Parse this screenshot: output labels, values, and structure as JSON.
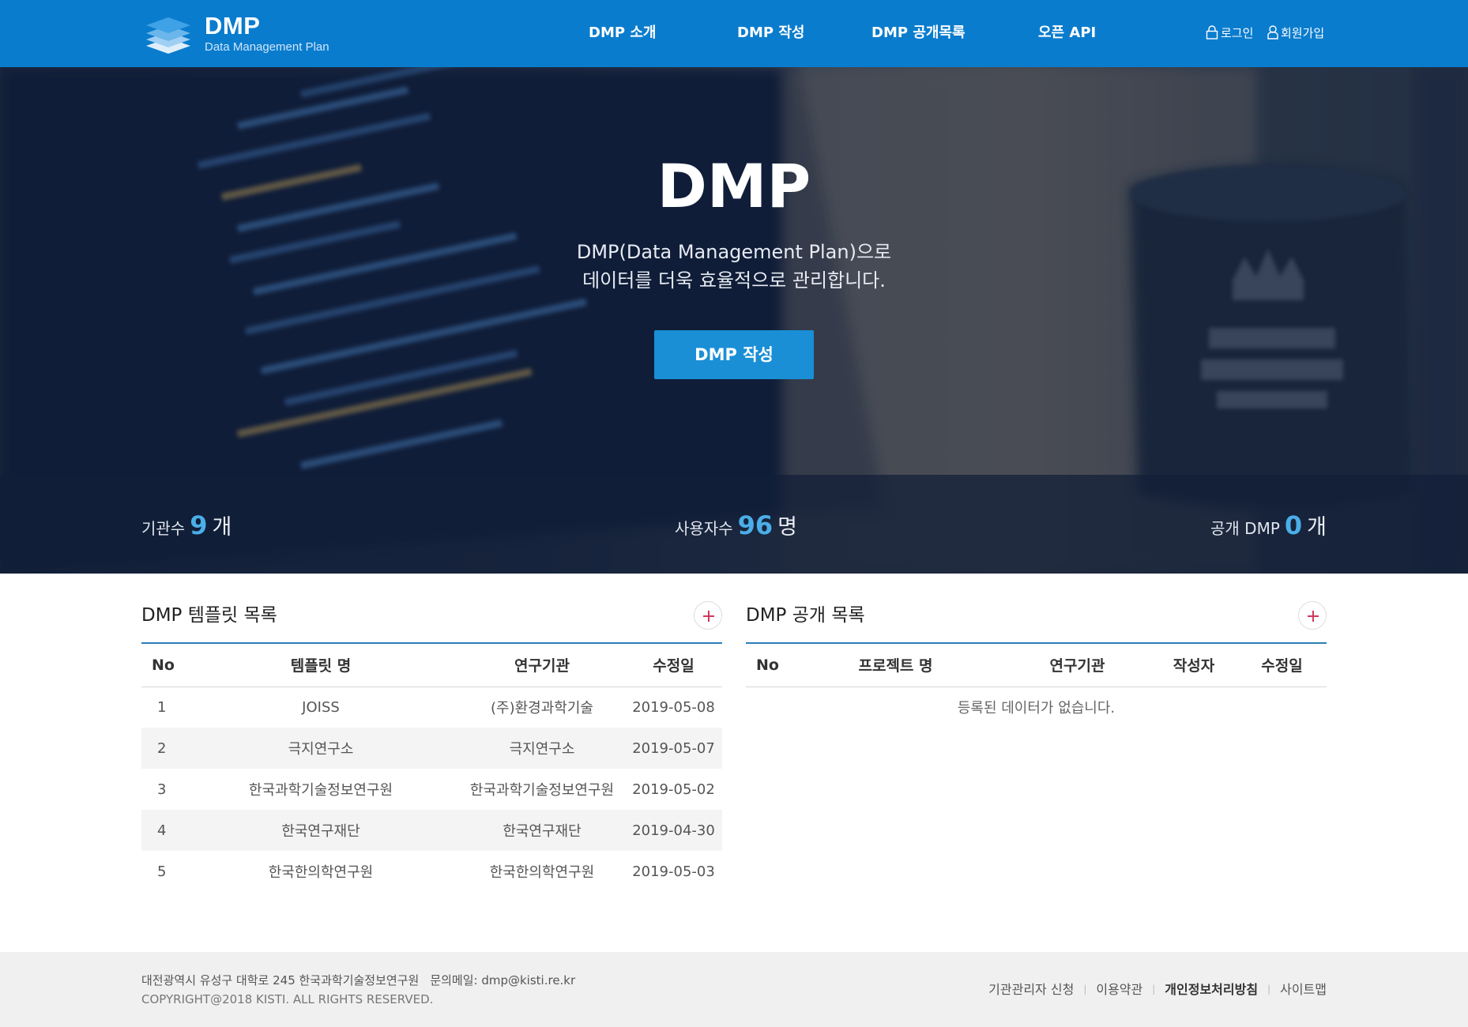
{
  "header": {
    "logo_title": "DMP",
    "logo_sub": "Data Management Plan",
    "nav": [
      "DMP 소개",
      "DMP 작성",
      "DMP 공개목록",
      "오픈 API"
    ],
    "login": "로그인",
    "signup": "회원가입",
    "colors": {
      "bar": "#0a7ccd"
    }
  },
  "hero": {
    "title": "DMP",
    "subtitle_line1": "DMP(Data Management Plan)으로",
    "subtitle_line2": "데이터를 더욱 효율적으로 관리합니다.",
    "button": "DMP 작성"
  },
  "stats": [
    {
      "label": "기관수",
      "value": "9",
      "unit": "개"
    },
    {
      "label": "사용자수",
      "value": "96",
      "unit": "명"
    },
    {
      "label": "공개 DMP",
      "value": "0",
      "unit": "개"
    }
  ],
  "template_panel": {
    "title": "DMP 템플릿 목록",
    "columns": [
      "No",
      "템플릿 명",
      "연구기관",
      "수정일"
    ],
    "rows": [
      [
        "1",
        "JOISS",
        "(주)환경과학기술",
        "2019-05-08"
      ],
      [
        "2",
        "극지연구소",
        "극지연구소",
        "2019-05-07"
      ],
      [
        "3",
        "한국과학기술정보연구원",
        "한국과학기술정보연구원",
        "2019-05-02"
      ],
      [
        "4",
        "한국연구재단",
        "한국연구재단",
        "2019-04-30"
      ],
      [
        "5",
        "한국한의학연구원",
        "한국한의학연구원",
        "2019-05-03"
      ]
    ]
  },
  "public_panel": {
    "title": "DMP 공개 목록",
    "columns": [
      "No",
      "프로젝트 명",
      "연구기관",
      "작성자",
      "수정일"
    ],
    "empty_message": "등록된 데이터가 없습니다."
  },
  "footer": {
    "address": "대전광역시 유성구 대학로 245 한국과학기술정보연구원",
    "email": "문의메일: dmp@kisti.re.kr",
    "copyright": "COPYRIGHT@2018 KISTI. ALL RIGHTS RESERVED.",
    "links": [
      "기관관리자 신청",
      "이용약관",
      "개인정보처리방침",
      "사이트맵"
    ]
  }
}
